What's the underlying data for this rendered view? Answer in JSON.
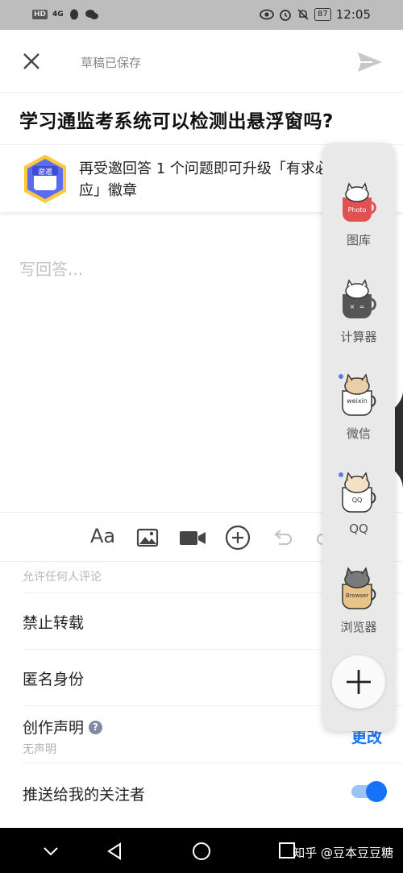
{
  "status_bar": {
    "badge": "HD",
    "network": "4G",
    "battery": "87",
    "time": "12:05"
  },
  "toolbar": {
    "draft_status": "草稿已保存",
    "close_icon": "close-icon",
    "send_icon": "send-icon"
  },
  "question": {
    "title": "学习通监考系统可以检测出悬浮窗吗?"
  },
  "invite": {
    "medal_text": "谢邀",
    "text": "再受邀回答 1 个问题即可升级「有求必应」徽章"
  },
  "editor": {
    "placeholder": "写回答..."
  },
  "format_toolbar": {
    "font_label": "Aa",
    "icons": [
      "font-icon",
      "image-icon",
      "video-icon",
      "add-circle-icon",
      "undo-icon",
      "redo-icon"
    ]
  },
  "settings": {
    "comment_hint": "允许任何人评论",
    "no_repost": "禁止转载",
    "anonymous": "匿名身份",
    "declaration": "创作声明",
    "declaration_value": "无声明",
    "change": "更改",
    "push_followers": "推送给我的关注者",
    "push_enabled": true
  },
  "dock": {
    "apps": [
      {
        "label": "图库",
        "icon": "cat-cup-photo-icon",
        "cup_text": "Photo"
      },
      {
        "label": "计算器",
        "icon": "cat-cup-calculator-icon",
        "cup_text": ""
      },
      {
        "label": "微信",
        "icon": "cat-cup-weixin-icon",
        "cup_text": "weixin"
      },
      {
        "label": "QQ",
        "icon": "cat-cup-qq-icon",
        "cup_text": "QQ"
      },
      {
        "label": "浏览器",
        "icon": "cat-cup-browser-icon",
        "cup_text": "Browser"
      }
    ],
    "add_icon": "plus-icon"
  },
  "navbar": {
    "watermark": "知乎 @豆本豆豆糖"
  },
  "colors": {
    "accent": "#1772f6",
    "status_bar": "#bdbdbd",
    "dock_bg": "#e9e9e9"
  }
}
